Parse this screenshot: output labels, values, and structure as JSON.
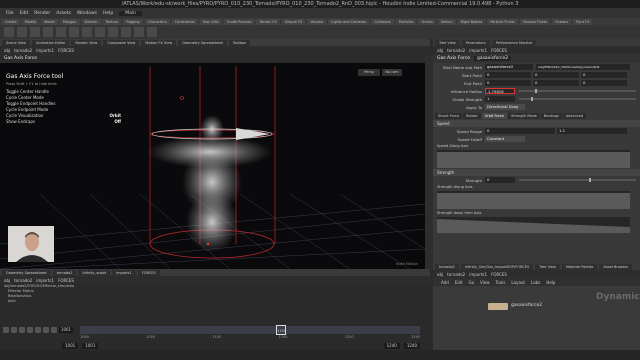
{
  "window": {
    "title": "/ATLAS/Work/edu-sk/work_files/PYRO/PYRO_010_230_Tornado/PYRO_010_230_Tornado2_RnD_003.hiplc - Houdini Indie Limited-Commercial 19.0.498 - Python 3"
  },
  "menu": [
    "File",
    "Edit",
    "Render",
    "Assets",
    "Windows",
    "Help",
    "",
    "Main"
  ],
  "shelf_tabs": [
    "Create",
    "Modify",
    "Model",
    "Polygon",
    "Deform",
    "Texture",
    "Rigging",
    "Characters",
    "Constraints",
    "Hair Utils",
    "Guide Process",
    "Terrain FX",
    "Simple FX",
    "Volume",
    "Lights and Cameras",
    "Collisions",
    "Particles",
    "Grains",
    "Vellum",
    "Rigid Bodies",
    "Particle Fluids",
    "Viscous Fluids",
    "Oceans",
    "Pyro FX",
    "FEM",
    "Wires",
    "Crowds",
    "Drive Simulation"
  ],
  "viewport": {
    "tabs": [
      "Scene View",
      "Animation Editor",
      "Render View",
      "Composite View",
      "Motion FX View",
      "Geometry Spreadsheet",
      "Toolbox"
    ],
    "path": [
      "obj",
      "tornado2",
      "imports1",
      "FORCES"
    ],
    "toolbar_title": "Gas Axis Force",
    "persp_label": "Persp",
    "cam_label": "No cam",
    "bottom_label": "Indie Edition",
    "hud": {
      "title": "Gas Axis Force tool",
      "hint": "Press Shift + F1 to hide hints",
      "items": [
        {
          "label": "Toggle Center Handle",
          "value": ""
        },
        {
          "label": "Cycle Center Mode",
          "value": ""
        },
        {
          "label": "Toggle Endpoint Handles",
          "value": ""
        },
        {
          "label": "Cycle Endpoint Mode",
          "value": ""
        },
        {
          "label": "Cycle Visualization",
          "value": "Orbit"
        },
        {
          "label": "Show Endcaps",
          "value": "Off"
        }
      ]
    }
  },
  "network_left": {
    "tabs": [
      "Geometry Spreadsheet",
      "tornado2",
      "Infinity_ansbt",
      "imports1",
      "FORCES"
    ],
    "path": [
      "obj",
      "tornado2",
      "imports1",
      "FORCES"
    ],
    "tree": [
      "obj/tornado2/FORCES/Effector_simulatio",
      "Effector Matrix",
      "Relationships",
      "Joint"
    ]
  },
  "timeline": {
    "current_frame": "1001",
    "marker_frame": "1150",
    "ticks": [
      "1000",
      "1050",
      "1100",
      "1150",
      "1200",
      "1240"
    ],
    "start": "1001",
    "start2": "1001",
    "end": "1240",
    "end2": "1240"
  },
  "right_panel": {
    "tabs": [
      "Tree View",
      "Parameters",
      "Performance Monitor"
    ],
    "path": [
      "obj",
      "tornado2",
      "imports1",
      "FORCES"
    ],
    "node_type": "Gas Axis Force",
    "node_name": "gasaxisforce2",
    "params": {
      "bind_name_label": "Bind Name and Path",
      "bind_name": "gasaxisforce2",
      "bind_path": "/obj/PYRO/010_230/tornado/pyrosim/$OS",
      "start_point_label": "Start Point",
      "start_point": [
        "0",
        "0",
        "0"
      ],
      "end_point_label": "End Point",
      "end_point": [
        "0",
        "0",
        "0"
      ],
      "influence_radius_label": "Influence Radius",
      "influence_radius": "1.75826",
      "global_strength_label": "Global Strength",
      "global_strength": "1",
      "apply_to_label": "Apply To",
      "apply_to": "Directional Drag"
    },
    "tabs2": [
      "Shock Force",
      "Rotate",
      "Orbit Force",
      "Strength Mode",
      "Bindings",
      "Advanced"
    ],
    "active_tab2": "Orbit Force",
    "sections": {
      "speed": "Speed",
      "strength": "Strength"
    },
    "speed_params": {
      "speed_range_label": "Speed Range",
      "speed_range": [
        "0",
        "1.1"
      ],
      "speed_falloff_label": "Speed Falloff",
      "speed_falloff": "Constant",
      "speed_along_axis": "Speed Along Axis"
    },
    "strength_params": {
      "strength_label": "Strength",
      "strength": "0",
      "strength_along_axis": "Strength Along Axis",
      "strength_away": "Strength Away from Axis"
    }
  },
  "network_right": {
    "tabs": [
      "tornado2",
      "Infinity_Sim/Gas_ImportDOP/FORCES",
      "Tree View",
      "Material Palette",
      "Asset Browser"
    ],
    "path": [
      "obj",
      "tornado2",
      "imports1",
      "FORCES"
    ],
    "menu": [
      "Add",
      "Edit",
      "Go",
      "View",
      "Tools",
      "Layout",
      "Labs",
      "Help"
    ],
    "node_label": "gasaxisforce2",
    "context_label": "Dynamics"
  }
}
